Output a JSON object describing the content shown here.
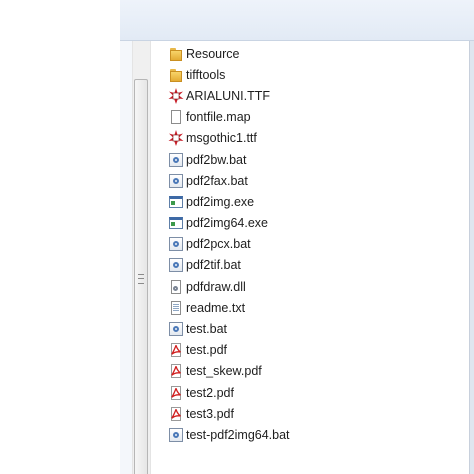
{
  "files": [
    {
      "name": "Resource",
      "icon": "folder-icon",
      "type": "folder"
    },
    {
      "name": "tifftools",
      "icon": "folder-icon",
      "type": "folder"
    },
    {
      "name": "ARIALUNI.TTF",
      "icon": "font-file-icon",
      "type": "font"
    },
    {
      "name": "fontfile.map",
      "icon": "document-icon",
      "type": "doc"
    },
    {
      "name": "msgothic1.ttf",
      "icon": "font-file-icon",
      "type": "font"
    },
    {
      "name": "pdf2bw.bat",
      "icon": "batch-file-icon",
      "type": "bat"
    },
    {
      "name": "pdf2fax.bat",
      "icon": "batch-file-icon",
      "type": "bat"
    },
    {
      "name": "pdf2img.exe",
      "icon": "executable-icon",
      "type": "exe"
    },
    {
      "name": "pdf2img64.exe",
      "icon": "executable-icon",
      "type": "exe"
    },
    {
      "name": "pdf2pcx.bat",
      "icon": "batch-file-icon",
      "type": "bat"
    },
    {
      "name": "pdf2tif.bat",
      "icon": "batch-file-icon",
      "type": "bat"
    },
    {
      "name": "pdfdraw.dll",
      "icon": "dll-file-icon",
      "type": "dll"
    },
    {
      "name": "readme.txt",
      "icon": "text-file-icon",
      "type": "txt"
    },
    {
      "name": "test.bat",
      "icon": "batch-file-icon",
      "type": "bat"
    },
    {
      "name": "test.pdf",
      "icon": "pdf-file-icon",
      "type": "pdf"
    },
    {
      "name": "test_skew.pdf",
      "icon": "pdf-file-icon",
      "type": "pdf"
    },
    {
      "name": "test2.pdf",
      "icon": "pdf-file-icon",
      "type": "pdf"
    },
    {
      "name": "test3.pdf",
      "icon": "pdf-file-icon",
      "type": "pdf"
    },
    {
      "name": "test-pdf2img64.bat",
      "icon": "batch-file-icon",
      "type": "bat"
    }
  ],
  "colors": {
    "header_bg": "#e2eaf5",
    "folder": "#f7d46a",
    "font_icon": "#c8202a",
    "pdf_icon": "#d11f1f",
    "text": "#1e1e1e"
  }
}
